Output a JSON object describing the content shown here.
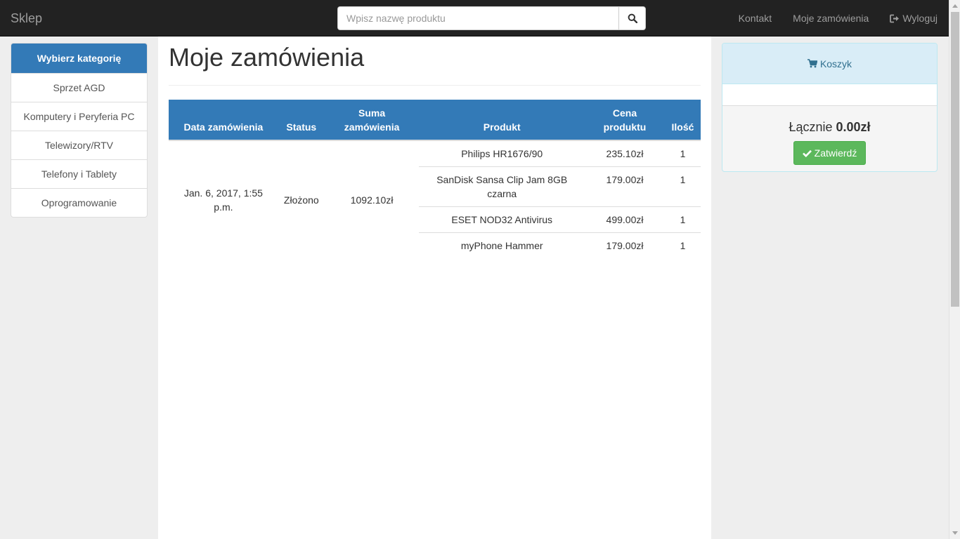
{
  "navbar": {
    "brand": "Sklep",
    "search_placeholder": "Wpisz nazwę produktu",
    "links": [
      "Kontakt",
      "Moje zamówienia",
      "Wyloguj"
    ]
  },
  "sidebar": {
    "header": "Wybierz kategorię",
    "items": [
      "Sprzet AGD",
      "Komputery i Peryferia PC",
      "Telewizory/RTV",
      "Telefony i Tablety",
      "Oprogramowanie"
    ]
  },
  "main": {
    "title": "Moje zamówienia",
    "table": {
      "headers": [
        "Data zamówienia",
        "Status",
        "Suma zamówienia",
        "Produkt",
        "Cena produktu",
        "Ilość"
      ],
      "order": {
        "date": "Jan. 6, 2017, 1:55 p.m.",
        "status": "Złożono",
        "total": "1092.10zł",
        "items": [
          {
            "product": "Philips HR1676/90",
            "price": "235.10zł",
            "qty": "1"
          },
          {
            "product": "SanDisk Sansa Clip Jam 8GB czarna",
            "price": "179.00zł",
            "qty": "1"
          },
          {
            "product": "ESET NOD32 Antivirus",
            "price": "499.00zł",
            "qty": "1"
          },
          {
            "product": "myPhone Hammer",
            "price": "179.00zł",
            "qty": "1"
          }
        ]
      }
    }
  },
  "cart": {
    "title": "Koszyk",
    "total_label": "Łącznie",
    "total_value": "0.00zł",
    "confirm_label": "Zatwierdź"
  },
  "colors": {
    "navbar": "#222222",
    "primary": "#337ab7",
    "success": "#5cb85c",
    "info_bg": "#d9edf7"
  }
}
